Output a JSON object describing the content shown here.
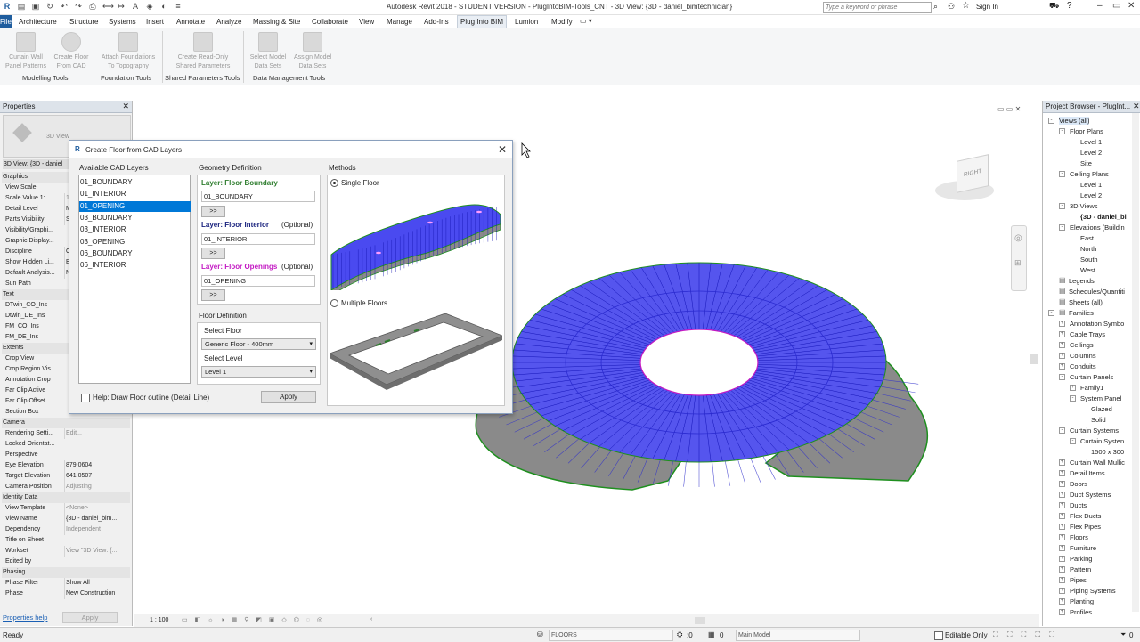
{
  "app": {
    "title": "Autodesk Revit 2018 - STUDENT VERSION -     PlugIntoBIM-Tools_CNT - 3D View: {3D - daniel_bimtechnician}",
    "search_placeholder": "Type a keyword or phrase",
    "sign_in": "Sign In",
    "file_tab": "File"
  },
  "ribbon_tabs": [
    "Architecture",
    "Structure",
    "Systems",
    "Insert",
    "Annotate",
    "Analyze",
    "Massing & Site",
    "Collaborate",
    "View",
    "Manage",
    "Add-Ins",
    "Plug Into BIM",
    "Lumion",
    "Modify"
  ],
  "ribbon": {
    "buttons": [
      {
        "line1": "Curtain Wall",
        "line2": "Panel Patterns"
      },
      {
        "line1": "Create Floor",
        "line2": "From CAD"
      },
      {
        "line1": "Attach Foundations",
        "line2": "To Topography"
      },
      {
        "line1": "Create Read-Only",
        "line2": "Shared Parameters"
      },
      {
        "line1": "Select Model",
        "line2": "Data Sets"
      },
      {
        "line1": "Assign Model",
        "line2": "Data Sets"
      }
    ],
    "groups": [
      "Modelling Tools",
      "Foundation Tools",
      "Shared Parameters Tools",
      "Data Management Tools"
    ]
  },
  "properties": {
    "title": "Properties",
    "type_label": "3D View",
    "view_selector": "3D View: {3D - daniel",
    "rows": [
      {
        "k": "Graphics",
        "v": "",
        "cat": true
      },
      {
        "k": "View Scale",
        "v": ""
      },
      {
        "k": "Scale Value    1:",
        "v": "1:"
      },
      {
        "k": "Detail Level",
        "v": "M"
      },
      {
        "k": "Parts Visibility",
        "v": "S"
      },
      {
        "k": "Visibility/Graphi...",
        "v": ""
      },
      {
        "k": "Graphic Display...",
        "v": ""
      },
      {
        "k": "Discipline",
        "v": "C"
      },
      {
        "k": "Show Hidden Li...",
        "v": "B"
      },
      {
        "k": "Default Analysis...",
        "v": "N"
      },
      {
        "k": "Sun Path",
        "v": ""
      },
      {
        "k": "Text",
        "v": "",
        "cat": true
      },
      {
        "k": "DTwin_CO_Ins",
        "v": ""
      },
      {
        "k": "Dtwin_DE_Ins",
        "v": ""
      },
      {
        "k": "FM_CO_Ins",
        "v": ""
      },
      {
        "k": "FM_DE_Ins",
        "v": ""
      },
      {
        "k": "Extents",
        "v": "",
        "cat": true
      },
      {
        "k": "Crop View",
        "v": ""
      },
      {
        "k": "Crop Region Vis...",
        "v": ""
      },
      {
        "k": "Annotation Crop",
        "v": ""
      },
      {
        "k": "Far Clip Active",
        "v": ""
      },
      {
        "k": "Far Clip Offset",
        "v": ""
      },
      {
        "k": "Section Box",
        "v": ""
      },
      {
        "k": "Camera",
        "v": "",
        "cat": true
      },
      {
        "k": "Rendering Setti...",
        "v": "Edit..."
      },
      {
        "k": "Locked Orientat...",
        "v": ""
      },
      {
        "k": "Perspective",
        "v": ""
      },
      {
        "k": "Eye Elevation",
        "v": "879.0604"
      },
      {
        "k": "Target Elevation",
        "v": "641.0507"
      },
      {
        "k": "Camera Position",
        "v": "Adjusting"
      },
      {
        "k": "Identity Data",
        "v": "",
        "cat": true
      },
      {
        "k": "View Template",
        "v": "<None>"
      },
      {
        "k": "View Name",
        "v": "{3D - daniel_bim..."
      },
      {
        "k": "Dependency",
        "v": "Independent"
      },
      {
        "k": "Title on Sheet",
        "v": ""
      },
      {
        "k": "Workset",
        "v": "View \"3D View: {..."
      },
      {
        "k": "Edited by",
        "v": ""
      },
      {
        "k": "Phasing",
        "v": "",
        "cat": true
      },
      {
        "k": "Phase Filter",
        "v": "Show All"
      },
      {
        "k": "Phase",
        "v": "New Construction"
      }
    ],
    "help_link": "Properties help",
    "apply": "Apply"
  },
  "dialog": {
    "title": "Create Floor from CAD Layers",
    "available_label": "Available CAD Layers",
    "layers": [
      "01_BOUNDARY",
      "01_INTERIOR",
      "01_OPENING",
      "03_BOUNDARY",
      "03_INTERIOR",
      "03_OPENING",
      "06_BOUNDARY",
      "06_INTERIOR"
    ],
    "selected_layer_index": 2,
    "geometry_label": "Geometry Definition",
    "boundary_label": "Layer: Floor Boundary",
    "boundary_value": "01_BOUNDARY",
    "interior_label": "Layer: Floor Interior",
    "interior_optional": "(Optional)",
    "interior_value": "01_INTERIOR",
    "openings_label": "Layer: Floor Openings",
    "openings_optional": "(Optional)",
    "openings_value": "01_OPENING",
    "add_button": ">>",
    "floor_def_label": "Floor Definition",
    "select_floor_label": "Select Floor",
    "select_floor_value": "Generic Floor - 400mm",
    "select_level_label": "Select Level",
    "select_level_value": "Level 1",
    "methods_label": "Methods",
    "single_floor": "Single Floor",
    "multiple_floors": "Multiple Floors",
    "help_checkbox": "Help: Draw Floor outline (Detail Line)",
    "apply": "Apply",
    "colors": {
      "boundary": "#2e7d2e",
      "interior": "#1a237e",
      "openings": "#c318c3"
    }
  },
  "view_cube": {
    "face": "RIGHT"
  },
  "browser": {
    "title": "Project Browser - PlugInt...",
    "items": [
      {
        "t": "Views (all)",
        "lvl": 0,
        "exp": "-",
        "sel": true
      },
      {
        "t": "Floor Plans",
        "lvl": 1,
        "exp": "-"
      },
      {
        "t": "Level 1",
        "lvl": 2
      },
      {
        "t": "Level 2",
        "lvl": 2
      },
      {
        "t": "Site",
        "lvl": 2
      },
      {
        "t": "Ceiling Plans",
        "lvl": 1,
        "exp": "-"
      },
      {
        "t": "Level 1",
        "lvl": 2
      },
      {
        "t": "Level 2",
        "lvl": 2
      },
      {
        "t": "3D Views",
        "lvl": 1,
        "exp": "-"
      },
      {
        "t": "{3D - daniel_bi",
        "lvl": 2,
        "bold": true
      },
      {
        "t": "Elevations (Buildin",
        "lvl": 1,
        "exp": "-"
      },
      {
        "t": "East",
        "lvl": 2
      },
      {
        "t": "North",
        "lvl": 2
      },
      {
        "t": "South",
        "lvl": 2
      },
      {
        "t": "West",
        "lvl": 2
      },
      {
        "t": "Legends",
        "lvl": 0,
        "ic": true
      },
      {
        "t": "Schedules/Quantiti",
        "lvl": 0,
        "ic": true
      },
      {
        "t": "Sheets (all)",
        "lvl": 0,
        "ic": true
      },
      {
        "t": "Families",
        "lvl": 0,
        "exp": "-",
        "ic": true
      },
      {
        "t": "Annotation Symbo",
        "lvl": 1,
        "exp": "+"
      },
      {
        "t": "Cable Trays",
        "lvl": 1,
        "exp": "+"
      },
      {
        "t": "Ceilings",
        "lvl": 1,
        "exp": "+"
      },
      {
        "t": "Columns",
        "lvl": 1,
        "exp": "+"
      },
      {
        "t": "Conduits",
        "lvl": 1,
        "exp": "+"
      },
      {
        "t": "Curtain Panels",
        "lvl": 1,
        "exp": "-"
      },
      {
        "t": "Family1",
        "lvl": 2,
        "exp": "+"
      },
      {
        "t": "System Panel",
        "lvl": 2,
        "exp": "-"
      },
      {
        "t": "Glazed",
        "lvl": 3
      },
      {
        "t": "Solid",
        "lvl": 3
      },
      {
        "t": "Curtain Systems",
        "lvl": 1,
        "exp": "-"
      },
      {
        "t": "Curtain Systen",
        "lvl": 2,
        "exp": "-"
      },
      {
        "t": "1500 x 300",
        "lvl": 3
      },
      {
        "t": "Curtain Wall Mullic",
        "lvl": 1,
        "exp": "+"
      },
      {
        "t": "Detail Items",
        "lvl": 1,
        "exp": "+"
      },
      {
        "t": "Doors",
        "lvl": 1,
        "exp": "+"
      },
      {
        "t": "Duct Systems",
        "lvl": 1,
        "exp": "+"
      },
      {
        "t": "Ducts",
        "lvl": 1,
        "exp": "+"
      },
      {
        "t": "Flex Ducts",
        "lvl": 1,
        "exp": "+"
      },
      {
        "t": "Flex Pipes",
        "lvl": 1,
        "exp": "+"
      },
      {
        "t": "Floors",
        "lvl": 1,
        "exp": "+"
      },
      {
        "t": "Furniture",
        "lvl": 1,
        "exp": "+"
      },
      {
        "t": "Parking",
        "lvl": 1,
        "exp": "+"
      },
      {
        "t": "Pattern",
        "lvl": 1,
        "exp": "+"
      },
      {
        "t": "Pipes",
        "lvl": 1,
        "exp": "+"
      },
      {
        "t": "Piping Systems",
        "lvl": 1,
        "exp": "+"
      },
      {
        "t": "Planting",
        "lvl": 1,
        "exp": "+"
      },
      {
        "t": "Profiles",
        "lvl": 1,
        "exp": "+"
      }
    ]
  },
  "view_control": {
    "scale": "1 : 100"
  },
  "status": {
    "ready": "Ready",
    "workset": "FLOORS",
    "sel_count": ":0",
    "model": "Main Model",
    "editable": "Editable Only",
    "zero": "0"
  }
}
